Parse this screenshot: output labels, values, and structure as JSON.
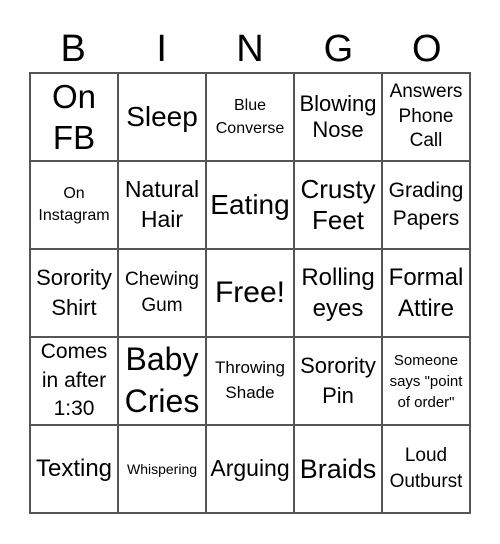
{
  "title_letters": [
    "B",
    "I",
    "N",
    "G",
    "O"
  ],
  "cells": [
    {
      "text": "On FB",
      "size": 33,
      "lh": 1.25
    },
    {
      "text": "Sleep",
      "size": 28,
      "lh": 1.2
    },
    {
      "text": "Blue Converse",
      "size": 16,
      "lh": 1.45
    },
    {
      "text": "Blowing Nose",
      "size": 22,
      "lh": 1.2
    },
    {
      "text": "Answers Phone Call",
      "size": 19,
      "lh": 1.3
    },
    {
      "text": "On Instagram",
      "size": 16,
      "lh": 1.4
    },
    {
      "text": "Natural Hair",
      "size": 23,
      "lh": 1.3
    },
    {
      "text": "Eating",
      "size": 28,
      "lh": 1.2
    },
    {
      "text": "Crusty Feet",
      "size": 26,
      "lh": 1.2
    },
    {
      "text": "Grading Papers",
      "size": 21,
      "lh": 1.35
    },
    {
      "text": "Sorority Shirt",
      "size": 22,
      "lh": 1.35
    },
    {
      "text": "Chewing Gum",
      "size": 19,
      "lh": 1.35
    },
    {
      "text": "Free!",
      "size": 30,
      "lh": 1.2
    },
    {
      "text": "Rolling eyes",
      "size": 24,
      "lh": 1.3
    },
    {
      "text": "Formal Attire",
      "size": 24,
      "lh": 1.3
    },
    {
      "text": "Comes in after 1:30",
      "size": 21,
      "lh": 1.35
    },
    {
      "text": "Baby Cries",
      "size": 32,
      "lh": 1.3
    },
    {
      "text": "Throwing Shade",
      "size": 17,
      "lh": 1.45
    },
    {
      "text": "Sorority Pin",
      "size": 22,
      "lh": 1.35
    },
    {
      "text": "Someone says \"point of order\"",
      "size": 15,
      "lh": 1.4
    },
    {
      "text": "Texting",
      "size": 24,
      "lh": 1.2
    },
    {
      "text": "Whispering",
      "size": 14,
      "lh": 1.2
    },
    {
      "text": "Arguing",
      "size": 23,
      "lh": 1.2
    },
    {
      "text": "Braids",
      "size": 27,
      "lh": 1.2
    },
    {
      "text": "Loud Outburst",
      "size": 19,
      "lh": 1.35
    }
  ]
}
